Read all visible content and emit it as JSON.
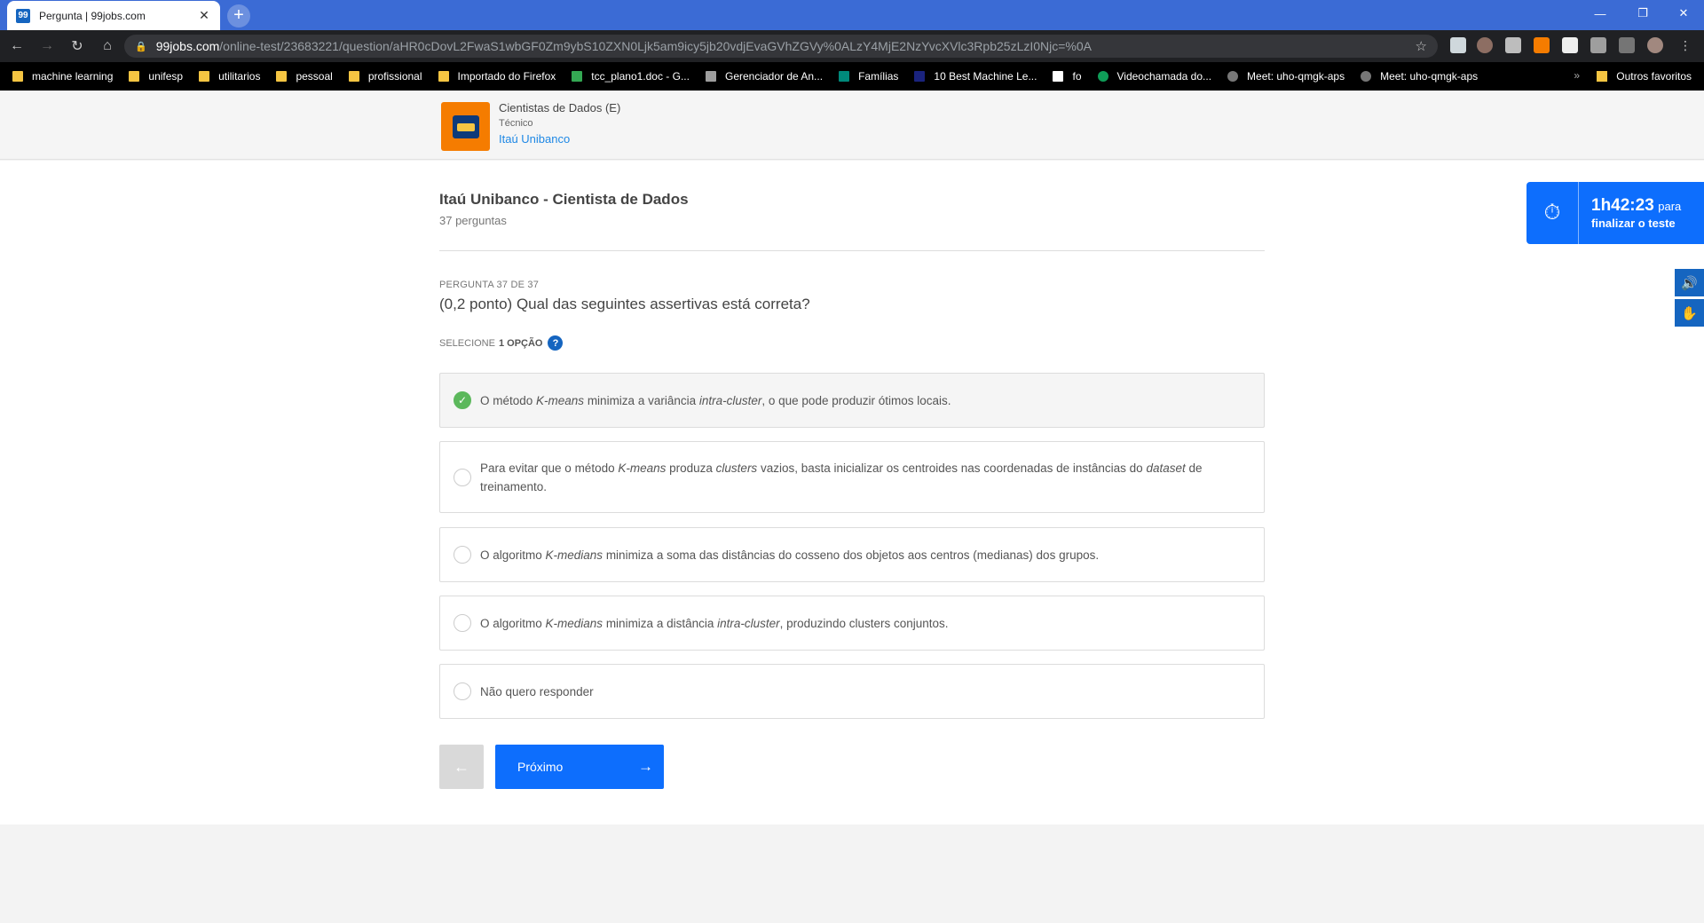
{
  "browser": {
    "tab_title": "Pergunta | 99jobs.com",
    "tab_favicon": "99",
    "url_host": "99jobs.com",
    "url_path": "/online-test/23683221/question/aHR0cDovL2FwaS1wbGF0Zm9ybS10ZXN0Ljk5am9icy5jb20vdjEvaGVhZGVy%0ALzY4MjE2NzYvcXVlc3Rpb25zLzI0Njc=%0A",
    "bookmarks": [
      {
        "label": "machine learning",
        "icon": "folder-icon"
      },
      {
        "label": "unifesp",
        "icon": "folder-icon"
      },
      {
        "label": "utilitarios",
        "icon": "folder-icon"
      },
      {
        "label": "pessoal",
        "icon": "folder-icon"
      },
      {
        "label": "profissional",
        "icon": "folder-icon"
      },
      {
        "label": "Importado do Firefox",
        "icon": "folder-icon"
      },
      {
        "label": "tcc_plano1.doc - G...",
        "icon": "drive-icon"
      },
      {
        "label": "Gerenciador de An...",
        "icon": "page-icon"
      },
      {
        "label": "Famílias",
        "icon": "page-icon"
      },
      {
        "label": "10 Best Machine Le...",
        "icon": "terminal-icon"
      },
      {
        "label": "fo",
        "icon": "wikipedia-icon"
      },
      {
        "label": "Videochamada do...",
        "icon": "hangouts-icon"
      },
      {
        "label": "Meet: uho-qmgk-aps",
        "icon": "globe-icon"
      },
      {
        "label": "Meet: uho-qmgk-aps",
        "icon": "globe-icon"
      }
    ],
    "other_bookmarks": "Outros favoritos"
  },
  "header": {
    "job_title": "Cientistas de Dados (E)",
    "level": "Técnico",
    "company": "Itaú Unibanco"
  },
  "test": {
    "title": "Itaú Unibanco - Cientista de Dados",
    "count": "37 perguntas",
    "question_number": "PERGUNTA 37 DE 37",
    "question": "(0,2 ponto) Qual das seguintes assertivas está correta?",
    "select_prefix": "SELECIONE",
    "select_count": "1 OPÇÃO",
    "help": "?",
    "options": [
      {
        "html": "O método <i>K-means</i> minimiza a variância <i>intra-cluster</i>, o que pode produzir ótimos locais.",
        "selected": true
      },
      {
        "html": "Para evitar que o método <i>K-means</i> produza <i>clusters</i> vazios, basta inicializar os centroides nas coordenadas de instâncias do <i>dataset</i> de treinamento.",
        "selected": false
      },
      {
        "html": "O algoritmo <i>K-medians</i> minimiza a soma das distâncias do cosseno dos objetos aos centros (medianas) dos grupos.",
        "selected": false
      },
      {
        "html": "O algoritmo <i>K-medians</i> minimiza a distância <i>intra-cluster</i>, produzindo clusters conjuntos.",
        "selected": false
      },
      {
        "html": "Não quero responder",
        "selected": false
      }
    ],
    "next_label": "Próximo"
  },
  "timer": {
    "time": "1h42:23",
    "para": "para",
    "subtitle": "finalizar o teste"
  },
  "colors": {
    "primary": "#0d6efd",
    "chrome_tabstrip": "#3b6bd5",
    "selected_check": "#5cb85c",
    "logo_orange": "#f57c00"
  }
}
